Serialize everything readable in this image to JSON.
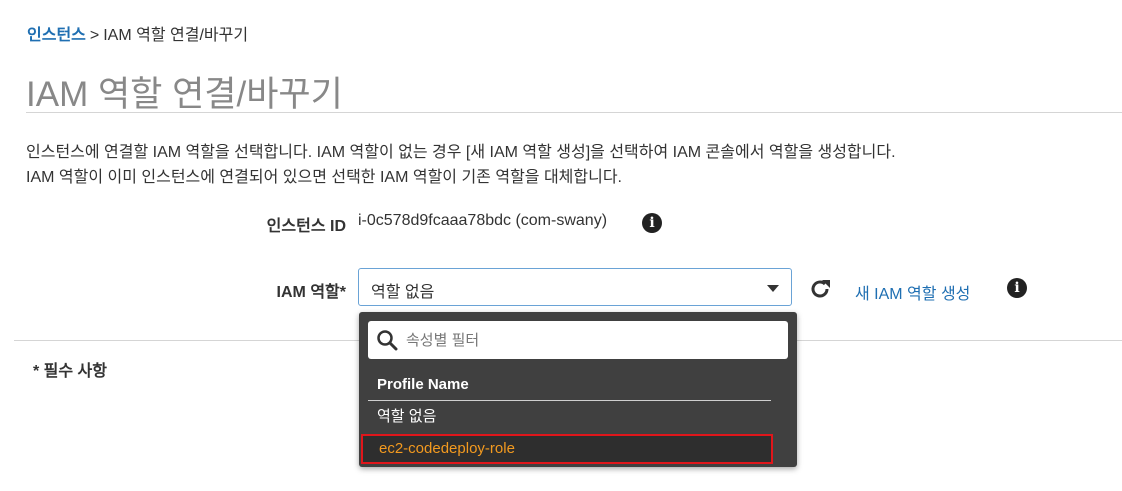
{
  "breadcrumb": {
    "root": "인스턴스",
    "separator": ">",
    "current": "IAM 역할 연결/바꾸기"
  },
  "page": {
    "title": "IAM 역할 연결/바꾸기",
    "description_line1": "인스턴스에 연결할 IAM 역할을 선택합니다. IAM 역할이 없는 경우 [새 IAM 역할 생성]을 선택하여 IAM 콘솔에서 역할을 생성합니다.",
    "description_line2": "IAM 역할이 이미 인스턴스에 연결되어 있으면 선택한 IAM 역할이 기존 역할을 대체합니다."
  },
  "form": {
    "instance_id_label": "인스턴스 ID",
    "instance_id_value": "i-0c578d9fcaaa78bdc (com-swany)",
    "iam_role_label": "IAM 역할*",
    "iam_role_selected": "역할 없음",
    "create_role_link": "새 IAM 역할 생성",
    "required_note": "* 필수 사항"
  },
  "dropdown": {
    "filter_placeholder": "속성별 필터",
    "column_header": "Profile Name",
    "options": [
      "역할 없음",
      "ec2-codedeploy-role"
    ]
  },
  "icons": {
    "info": "info-icon",
    "refresh": "refresh-icon",
    "search": "search-icon",
    "caret": "chevron-down-icon"
  },
  "colors": {
    "link": "#1f6fb2",
    "highlight_text": "#f39a1f",
    "highlight_border": "#e0161b",
    "dropdown_bg": "#404040"
  }
}
